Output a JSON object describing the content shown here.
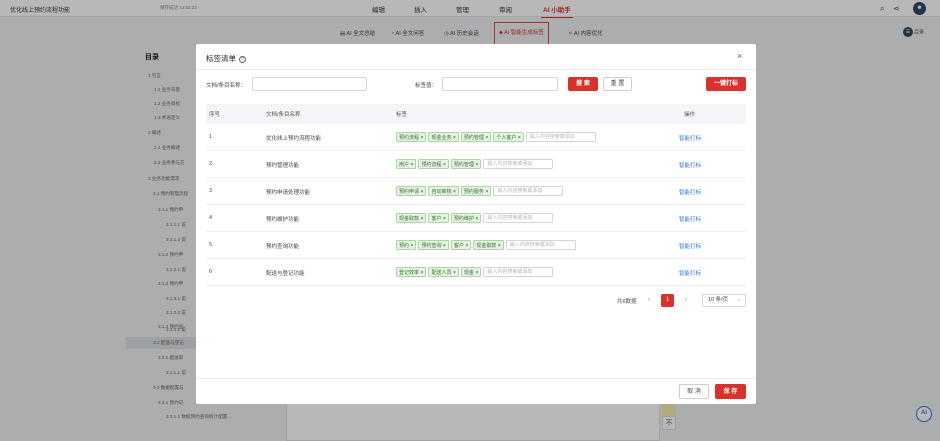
{
  "app": {
    "doc_title": "优化线上预约流程功能",
    "save_status": "保存成功 13:52:23",
    "menus": [
      "编辑",
      "插入",
      "管理",
      "审阅",
      "AI 小助手"
    ],
    "active_menu": "AI 小助手"
  },
  "toolbar": {
    "items": [
      "AI 全文总结",
      "AI 全文问答",
      "AI 历史会话",
      "AI 智能生成标签",
      "AI 内容优化"
    ],
    "highlighted": "AI 智能生成标签",
    "side_button": "目录"
  },
  "outline": {
    "title": "目录",
    "items": [
      "1 引言",
      "1.1 业务背景",
      "1.2 业务目标",
      "1.3 术语定义",
      "2 概述",
      "2.1 业务概述",
      "2.2 业务参与方",
      "3 业务功能需求",
      "3.1 预约管理流程",
      "3.1.1 预约申",
      "3.1.1.1 说",
      "3.1.1.2 说",
      "3.1.2 预约申",
      "3.1.2.1 说",
      "3.1.3 预约申",
      "3.1.3.1 说",
      "3.1.3.2 说",
      "3.1.4 预约查",
      "3.1.4.1 说",
      "3.2 配送与登记",
      "3.2.1 配送单",
      "3.2.1.1 说",
      "3.3 数据配置与",
      "3.3.1 预约记",
      "3.3.1.1 数据预约查询统计配置..."
    ]
  },
  "page_number": "不",
  "ai_float": "Ai",
  "modal": {
    "title": "标签清单",
    "filters": {
      "name_label": "文档/条目名称：",
      "name_value": "",
      "tag_label": "标签值：",
      "tag_value": "",
      "search_button": "搜 索",
      "reset_button": "重 置",
      "batch_button": "一键打标"
    },
    "table": {
      "headers": [
        "序号",
        "文档/条目名称",
        "标签",
        "操作"
      ],
      "rows": [
        {
          "index": "1",
          "name": "优化线上预约流程功能",
          "tags": [
            "预约流程",
            "现金业务",
            "预约管理",
            "个人客户"
          ],
          "action": "智能打标"
        },
        {
          "index": "2",
          "name": "预约管理功能",
          "tags": [
            "用户",
            "预约流程",
            "预约管理"
          ],
          "action": "智能打标"
        },
        {
          "index": "3",
          "name": "预约申请处理功能",
          "tags": [
            "预约申请",
            "自动审核",
            "预约服务"
          ],
          "action": "智能打标"
        },
        {
          "index": "4",
          "name": "预约维护功能",
          "tags": [
            "现金取款",
            "客户",
            "预约维护"
          ],
          "action": "智能打标"
        },
        {
          "index": "5",
          "name": "预约查询功能",
          "tags": [
            "预约",
            "预约查询",
            "客户",
            "现金取款"
          ],
          "action": "智能打标"
        },
        {
          "index": "6",
          "name": "配送与登记功能",
          "tags": [
            "登记效率",
            "配送人员",
            "现金"
          ],
          "action": "智能打标"
        }
      ],
      "tag_input_placeholder": "输入内容搜索或添加"
    },
    "pagination": {
      "total": "共6数据",
      "current_page": "1",
      "page_size": "10 条/页"
    },
    "footer": {
      "cancel": "取 消",
      "save": "保 存"
    }
  }
}
